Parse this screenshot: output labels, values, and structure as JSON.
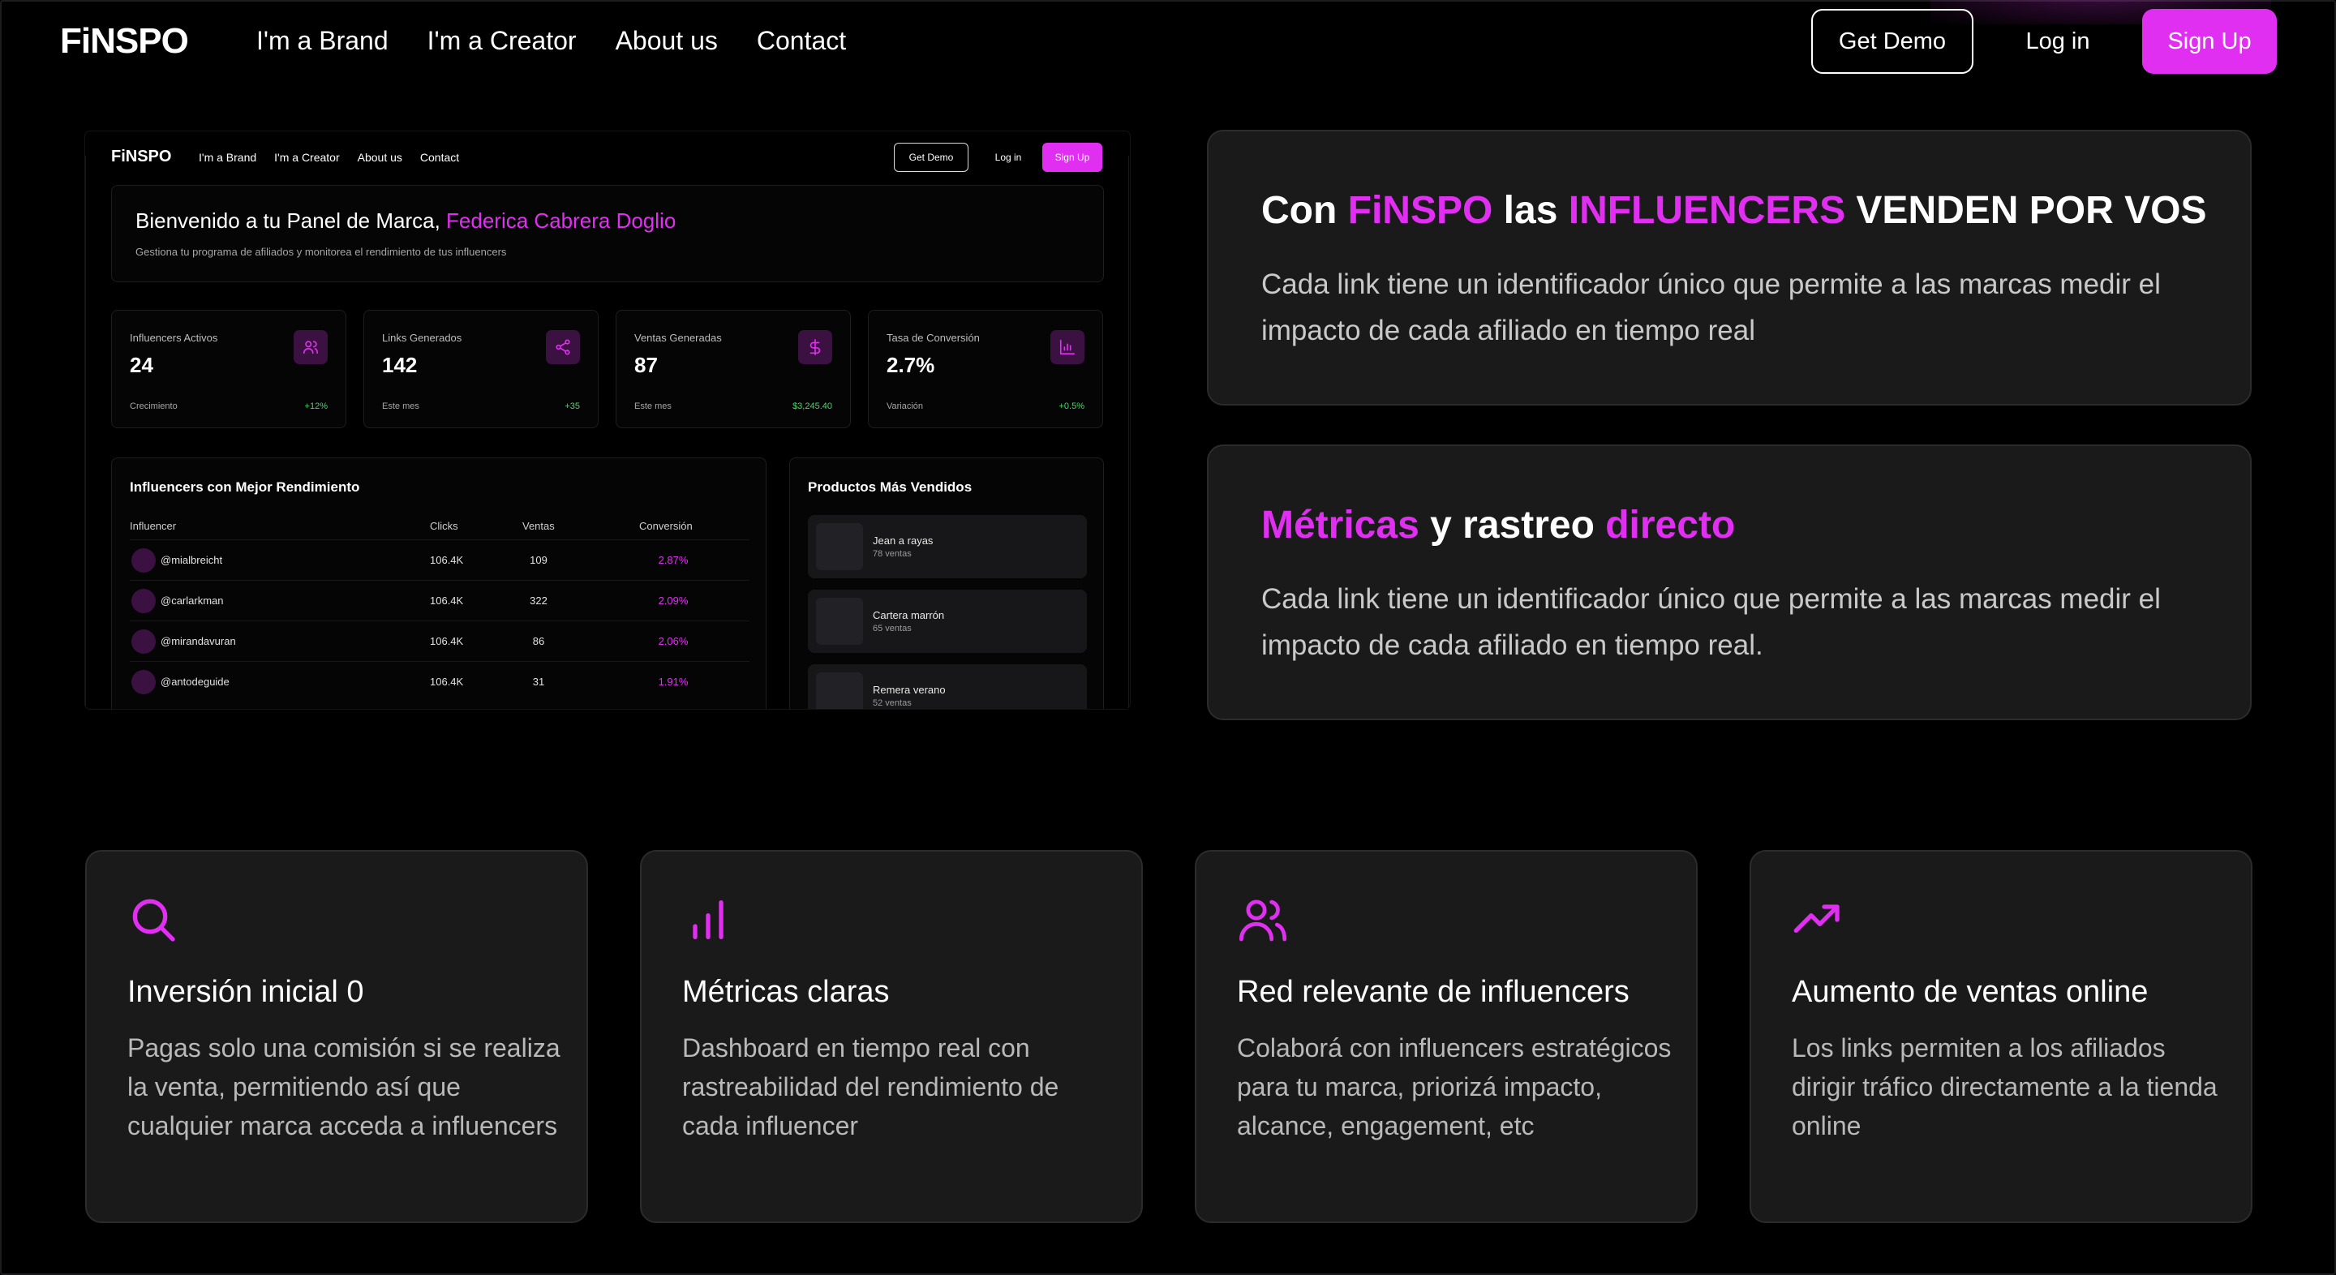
{
  "nav": {
    "logo": "FiNSPO",
    "links": [
      "I'm a Brand",
      "I'm a Creator",
      "About us",
      "Contact"
    ],
    "get_demo": "Get Demo",
    "login": "Log in",
    "signup": "Sign Up"
  },
  "preview": {
    "nav": {
      "logo": "FiNSPO",
      "links": [
        "I'm a Brand",
        "I'm a Creator",
        "About us",
        "Contact"
      ],
      "get_demo": "Get Demo",
      "login": "Log in",
      "signup": "Sign Up"
    },
    "welcome": {
      "prefix": "Bienvenido a tu Panel de Marca, ",
      "name": "Federica Cabrera Doglio",
      "subtitle": "Gestiona tu programa de afiliados y monitorea el rendimiento de tus influencers"
    },
    "stats": [
      {
        "label": "Influencers Activos",
        "value": "24",
        "foot": "Crecimiento",
        "delta": "+12%",
        "icon": "users-icon"
      },
      {
        "label": "Links Generados",
        "value": "142",
        "foot": "Este mes",
        "delta": "+35",
        "icon": "share-icon"
      },
      {
        "label": "Ventas Generadas",
        "value": "87",
        "foot": "Este mes",
        "delta": "$3,245.40",
        "icon": "dollar-icon"
      },
      {
        "label": "Tasa de Conversión",
        "value": "2.7%",
        "foot": "Variación",
        "delta": "+0.5%",
        "icon": "bar-chart-icon"
      }
    ],
    "table": {
      "title": "Influencers con Mejor Rendimiento",
      "headers": [
        "Influencer",
        "Clicks",
        "Ventas",
        "Conversión"
      ],
      "rows": [
        {
          "user": "@mialbreicht",
          "clicks": "106.4K",
          "ventas": "109",
          "conv": "2.87%"
        },
        {
          "user": "@carlarkman",
          "clicks": "106.4K",
          "ventas": "322",
          "conv": "2.09%"
        },
        {
          "user": "@mirandavuran",
          "clicks": "106.4K",
          "ventas": "86",
          "conv": "2.06%"
        },
        {
          "user": "@antodeguide",
          "clicks": "106.4K",
          "ventas": "31",
          "conv": "1.91%"
        }
      ]
    },
    "products": {
      "title": "Productos Más Vendidos",
      "items": [
        {
          "name": "Jean a rayas",
          "sales": "78 ventas"
        },
        {
          "name": "Cartera marrón",
          "sales": "65 ventas"
        },
        {
          "name": "Remera verano",
          "sales": "52 ventas"
        }
      ]
    }
  },
  "panels": {
    "first": {
      "t1": "Con ",
      "t2": "FiNSPO",
      "t3": " las ",
      "t4": "INFLUENCERS",
      "t5": " VENDEN POR VOS",
      "body": "Cada link tiene un identificador único que permite a las marcas medir el impacto de cada afiliado en tiempo real"
    },
    "second": {
      "t1": "Métricas",
      "t2": " y rastreo ",
      "t3": "directo",
      "body": "Cada link tiene un identificador único que permite a las marcas medir el impacto de cada afiliado en tiempo real."
    }
  },
  "cards": [
    {
      "icon": "search-icon",
      "title": "Inversión inicial 0",
      "body": "Pagas solo una comisión si se realiza la venta, permitiendo así que cualquier marca acceda a influencers"
    },
    {
      "icon": "bar-chart-icon",
      "title": "Métricas claras",
      "body": "Dashboard en tiempo real con rastreabilidad del rendimiento de cada influencer"
    },
    {
      "icon": "users-icon",
      "title": "Red relevante de influencers",
      "body": "Colaborá con influencers estratégicos para tu marca, priorizá impacto, alcance, engagement, etc"
    },
    {
      "icon": "trending-up-icon",
      "title": "Aumento de ventas online",
      "body": "Los links permiten a los afiliados dirigir tráfico directamente a la tienda online"
    }
  ],
  "colors": {
    "accent": "#e02ff0",
    "background": "#000000",
    "panel": "#1a1a1b",
    "positive": "#4cd46a"
  }
}
